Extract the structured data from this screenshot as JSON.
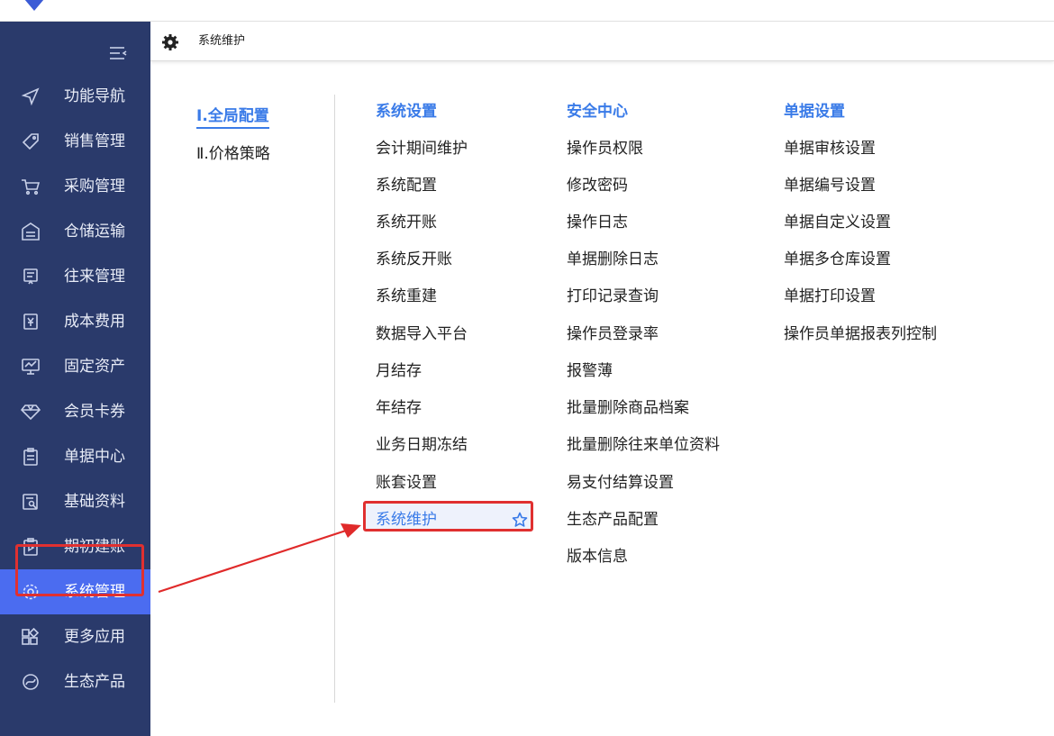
{
  "breadcrumb": {
    "title": "系统维护"
  },
  "sidebar": {
    "items": [
      {
        "label": "功能导航"
      },
      {
        "label": "销售管理"
      },
      {
        "label": "采购管理"
      },
      {
        "label": "仓储运输"
      },
      {
        "label": "往来管理"
      },
      {
        "label": "成本费用"
      },
      {
        "label": "固定资产"
      },
      {
        "label": "会员卡券"
      },
      {
        "label": "单据中心"
      },
      {
        "label": "基础资料"
      },
      {
        "label": "期初建账"
      },
      {
        "label": "系统管理"
      },
      {
        "label": "更多应用"
      },
      {
        "label": "生态产品"
      }
    ],
    "active": "系统管理"
  },
  "config_menu": {
    "global": "Ⅰ.全局配置",
    "price": "Ⅱ.价格策略"
  },
  "columns": [
    {
      "title": "系统设置",
      "items": [
        "会计期间维护",
        "系统配置",
        "系统开账",
        "系统反开账",
        "系统重建",
        "数据导入平台",
        "月结存",
        "年结存",
        "业务日期冻结",
        "账套设置",
        "系统维护"
      ]
    },
    {
      "title": "安全中心",
      "items": [
        "操作员权限",
        "修改密码",
        "操作日志",
        "单据删除日志",
        "打印记录查询",
        "操作员登录率",
        "报警薄",
        "批量删除商品档案",
        "批量删除往来单位资料",
        "易支付结算设置",
        "生态产品配置",
        "版本信息"
      ]
    },
    {
      "title": "单据设置",
      "items": [
        "单据审核设置",
        "单据编号设置",
        "单据自定义设置",
        "单据多仓库设置",
        "单据打印设置",
        "操作员单据报表列控制"
      ]
    }
  ],
  "colors": {
    "sidebar_bg": "#2a3a6b",
    "active_bg": "#4b6cf0",
    "accent": "#3a7be8",
    "highlight_red": "#e03030"
  }
}
